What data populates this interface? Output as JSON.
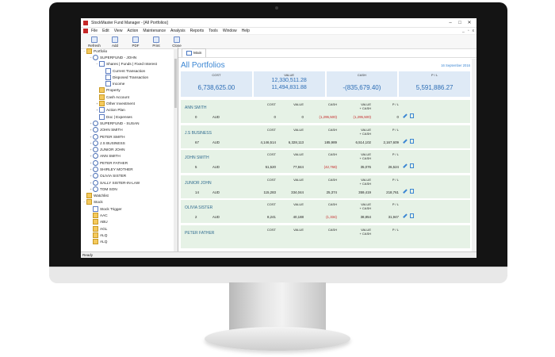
{
  "window": {
    "title": "StockMaster Fund Manager - [All Portfolios]"
  },
  "menu": [
    "File",
    "Edit",
    "View",
    "Action",
    "Maintenance",
    "Analysis",
    "Reports",
    "Tools",
    "Window",
    "Help"
  ],
  "toolbar": [
    {
      "label": "Refresh",
      "icon": "refresh-icon"
    },
    {
      "label": "Add",
      "icon": "add-icon"
    },
    {
      "label": "PDF",
      "icon": "pdf-icon"
    },
    {
      "label": "Print",
      "icon": "print-icon"
    },
    {
      "label": "Close",
      "icon": "close-icon"
    }
  ],
  "tree": [
    {
      "label": "Portfolio",
      "level": 0,
      "exp": "−",
      "icon": "folder"
    },
    {
      "label": "SUPERFUND - JOHN",
      "level": 1,
      "exp": "−",
      "icon": "person"
    },
    {
      "label": "Shares | Funds | Fixed Interest",
      "level": 2,
      "exp": "−",
      "icon": "doc"
    },
    {
      "label": "Current Transaction",
      "level": 3,
      "exp": "",
      "icon": "doc"
    },
    {
      "label": "Disposed Transaction",
      "level": 3,
      "exp": "",
      "icon": "doc"
    },
    {
      "label": "Income",
      "level": 3,
      "exp": "",
      "icon": "doc"
    },
    {
      "label": "Property",
      "level": 2,
      "exp": "",
      "icon": "folder"
    },
    {
      "label": "Cash Account",
      "level": 2,
      "exp": "",
      "icon": "folder"
    },
    {
      "label": "Other Investment",
      "level": 2,
      "exp": "+",
      "icon": "folder"
    },
    {
      "label": "Action Plan",
      "level": 2,
      "exp": "+",
      "icon": "doc"
    },
    {
      "label": "Doc | Expenses",
      "level": 2,
      "exp": "",
      "icon": "doc"
    },
    {
      "label": "SUPERFUND - SUSAN",
      "level": 1,
      "exp": "+",
      "icon": "person"
    },
    {
      "label": "JOHN SMITH",
      "level": 1,
      "exp": "+",
      "icon": "person"
    },
    {
      "label": "PETER SMITH",
      "level": 1,
      "exp": "+",
      "icon": "person"
    },
    {
      "label": "J.S BUSINESS",
      "level": 1,
      "exp": "+",
      "icon": "person"
    },
    {
      "label": "JUNIOR JOHN",
      "level": 1,
      "exp": "+",
      "icon": "person"
    },
    {
      "label": "ANN SMITH",
      "level": 1,
      "exp": "+",
      "icon": "person"
    },
    {
      "label": "PETER FATHER",
      "level": 1,
      "exp": "+",
      "icon": "person"
    },
    {
      "label": "SHIRLEY MOTHER",
      "level": 1,
      "exp": "+",
      "icon": "person"
    },
    {
      "label": "OLIVIA SISTER",
      "level": 1,
      "exp": "+",
      "icon": "person"
    },
    {
      "label": "SALLY SISTER-IN-LAW",
      "level": 1,
      "exp": "+",
      "icon": "person"
    },
    {
      "label": "TOM SON",
      "level": 1,
      "exp": "+",
      "icon": "person"
    },
    {
      "label": "Watchlist",
      "level": 0,
      "exp": "",
      "icon": "folder"
    },
    {
      "label": "Stock",
      "level": 0,
      "exp": "−",
      "icon": "folder"
    },
    {
      "label": "Stock Trigger",
      "level": 1,
      "exp": "",
      "icon": "doc"
    },
    {
      "label": "AAC",
      "level": 1,
      "exp": "",
      "icon": "folder"
    },
    {
      "label": "ABU",
      "level": 1,
      "exp": "",
      "icon": "folder"
    },
    {
      "label": "AGL",
      "level": 1,
      "exp": "",
      "icon": "folder"
    },
    {
      "label": "ALQ",
      "level": 1,
      "exp": "",
      "icon": "folder"
    },
    {
      "label": "ALQ",
      "level": 1,
      "exp": "",
      "icon": "folder"
    }
  ],
  "tab": {
    "label": "Main"
  },
  "page": {
    "title": "All Portfolios",
    "date": "16 September 2016"
  },
  "summary": {
    "cost_label": "COST",
    "cost": "6,738,625.00",
    "value_label": "VALUE",
    "value1": "12,330,511.28",
    "value2": "11,494,831.88",
    "cash_label": "CASH",
    "cash": "-(835,679.40)",
    "pl_label": "P / L",
    "pl": "5,591,886.27"
  },
  "headers": {
    "cost": "COST",
    "value": "VALUE",
    "cash": "CASH",
    "vc": "VALUE\n+ CASH",
    "pl": "P / L"
  },
  "portfolios": [
    {
      "name": "ANN SMITH",
      "qty": "0",
      "cur": "AUD",
      "cost": "0",
      "value": "0",
      "cash": "(1,295,500)",
      "vc": "(1,295,500)",
      "pl": "0",
      "cash_neg": true,
      "vc_neg": true
    },
    {
      "name": "J.S BUSINESS",
      "qty": "67",
      "cur": "AUD",
      "cost": "4,146,514",
      "value": "6,328,113",
      "cash": "185,989",
      "vc": "6,514,102",
      "pl": "2,167,609",
      "cash_neg": false,
      "vc_neg": false
    },
    {
      "name": "JOHN SMITH",
      "qty": "5",
      "cur": "AUD",
      "cost": "51,520",
      "value": "77,844",
      "cash": "(42,768)",
      "vc": "35,076",
      "pl": "26,524",
      "cash_neg": true,
      "vc_neg": false
    },
    {
      "name": "JUNIOR JOHN",
      "qty": "14",
      "cur": "AUD",
      "cost": "115,283",
      "value": "334,044",
      "cash": "25,374",
      "vc": "359,419",
      "pl": "218,761",
      "cash_neg": false,
      "vc_neg": false
    },
    {
      "name": "OLIVIA SISTER",
      "qty": "2",
      "cur": "AUD",
      "cost": "8,241",
      "value": "40,188",
      "cash": "(1,334)",
      "vc": "38,854",
      "pl": "31,947",
      "cash_neg": true,
      "vc_neg": false
    },
    {
      "name": "PETER FATHER",
      "qty": "",
      "cur": "",
      "cost": "",
      "value": "",
      "cash": "",
      "vc": "",
      "pl": "",
      "cash_neg": false,
      "vc_neg": false
    }
  ],
  "status": "Ready"
}
